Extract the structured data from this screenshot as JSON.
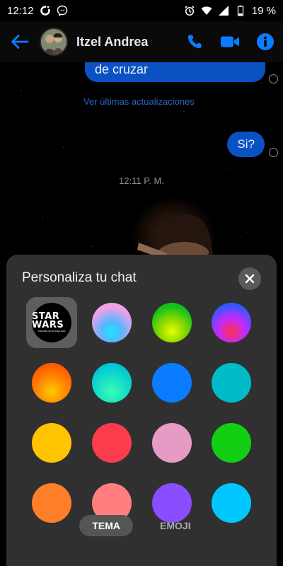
{
  "status_bar": {
    "time": "12:12",
    "battery": "19 %",
    "icons": [
      "sync-icon",
      "messenger-icon",
      "alarm-icon",
      "wifi-icon",
      "signal-icon",
      "battery-icon"
    ]
  },
  "app_bar": {
    "contact_name": "Itzel Andrea",
    "accent": "#0a7cff"
  },
  "chat": {
    "incoming_partial": "de cruzar",
    "see_updates": "Ver últimas actualizaciones",
    "outgoing": "Si?",
    "timestamp": "12:11 P. M."
  },
  "sheet": {
    "title": "Personaliza tu chat",
    "featured_theme": {
      "logo": "STAR WARS",
      "subtitle": "THE RISE OF SKYWALKER"
    },
    "themes": [
      {
        "name": "star-wars",
        "kind": "image"
      },
      {
        "name": "pink-blue-gradient",
        "colors": [
          "#f3a0e6",
          "#55b7ff",
          "#1ce6ff"
        ]
      },
      {
        "name": "green-yellow-gradient",
        "colors": [
          "#10c21b",
          "#e6ff00"
        ]
      },
      {
        "name": "purple-red-gradient",
        "colors": [
          "#2a5bff",
          "#c02bff",
          "#ff2f4b"
        ]
      },
      {
        "name": "orange-gradient",
        "colors": [
          "#ff5a00",
          "#ffcc00"
        ]
      },
      {
        "name": "teal-gradient",
        "colors": [
          "#00c6d6",
          "#39ffb0"
        ]
      },
      {
        "name": "blue",
        "colors": [
          "#0a7cff"
        ]
      },
      {
        "name": "teal",
        "colors": [
          "#00bcc9"
        ]
      },
      {
        "name": "yellow",
        "colors": [
          "#ffc300"
        ]
      },
      {
        "name": "red",
        "colors": [
          "#fa3c4c"
        ]
      },
      {
        "name": "pink",
        "colors": [
          "#e69bc4"
        ]
      },
      {
        "name": "green",
        "colors": [
          "#13cf13"
        ]
      },
      {
        "name": "orange",
        "colors": [
          "#ff7e29"
        ]
      },
      {
        "name": "coral",
        "colors": [
          "#ff7e7e"
        ]
      },
      {
        "name": "violet",
        "colors": [
          "#8a4dff"
        ]
      },
      {
        "name": "sky",
        "colors": [
          "#00c8ff"
        ]
      }
    ],
    "tabs": [
      {
        "label": "TEMA",
        "active": true
      },
      {
        "label": "EMOJI",
        "active": false
      }
    ]
  }
}
